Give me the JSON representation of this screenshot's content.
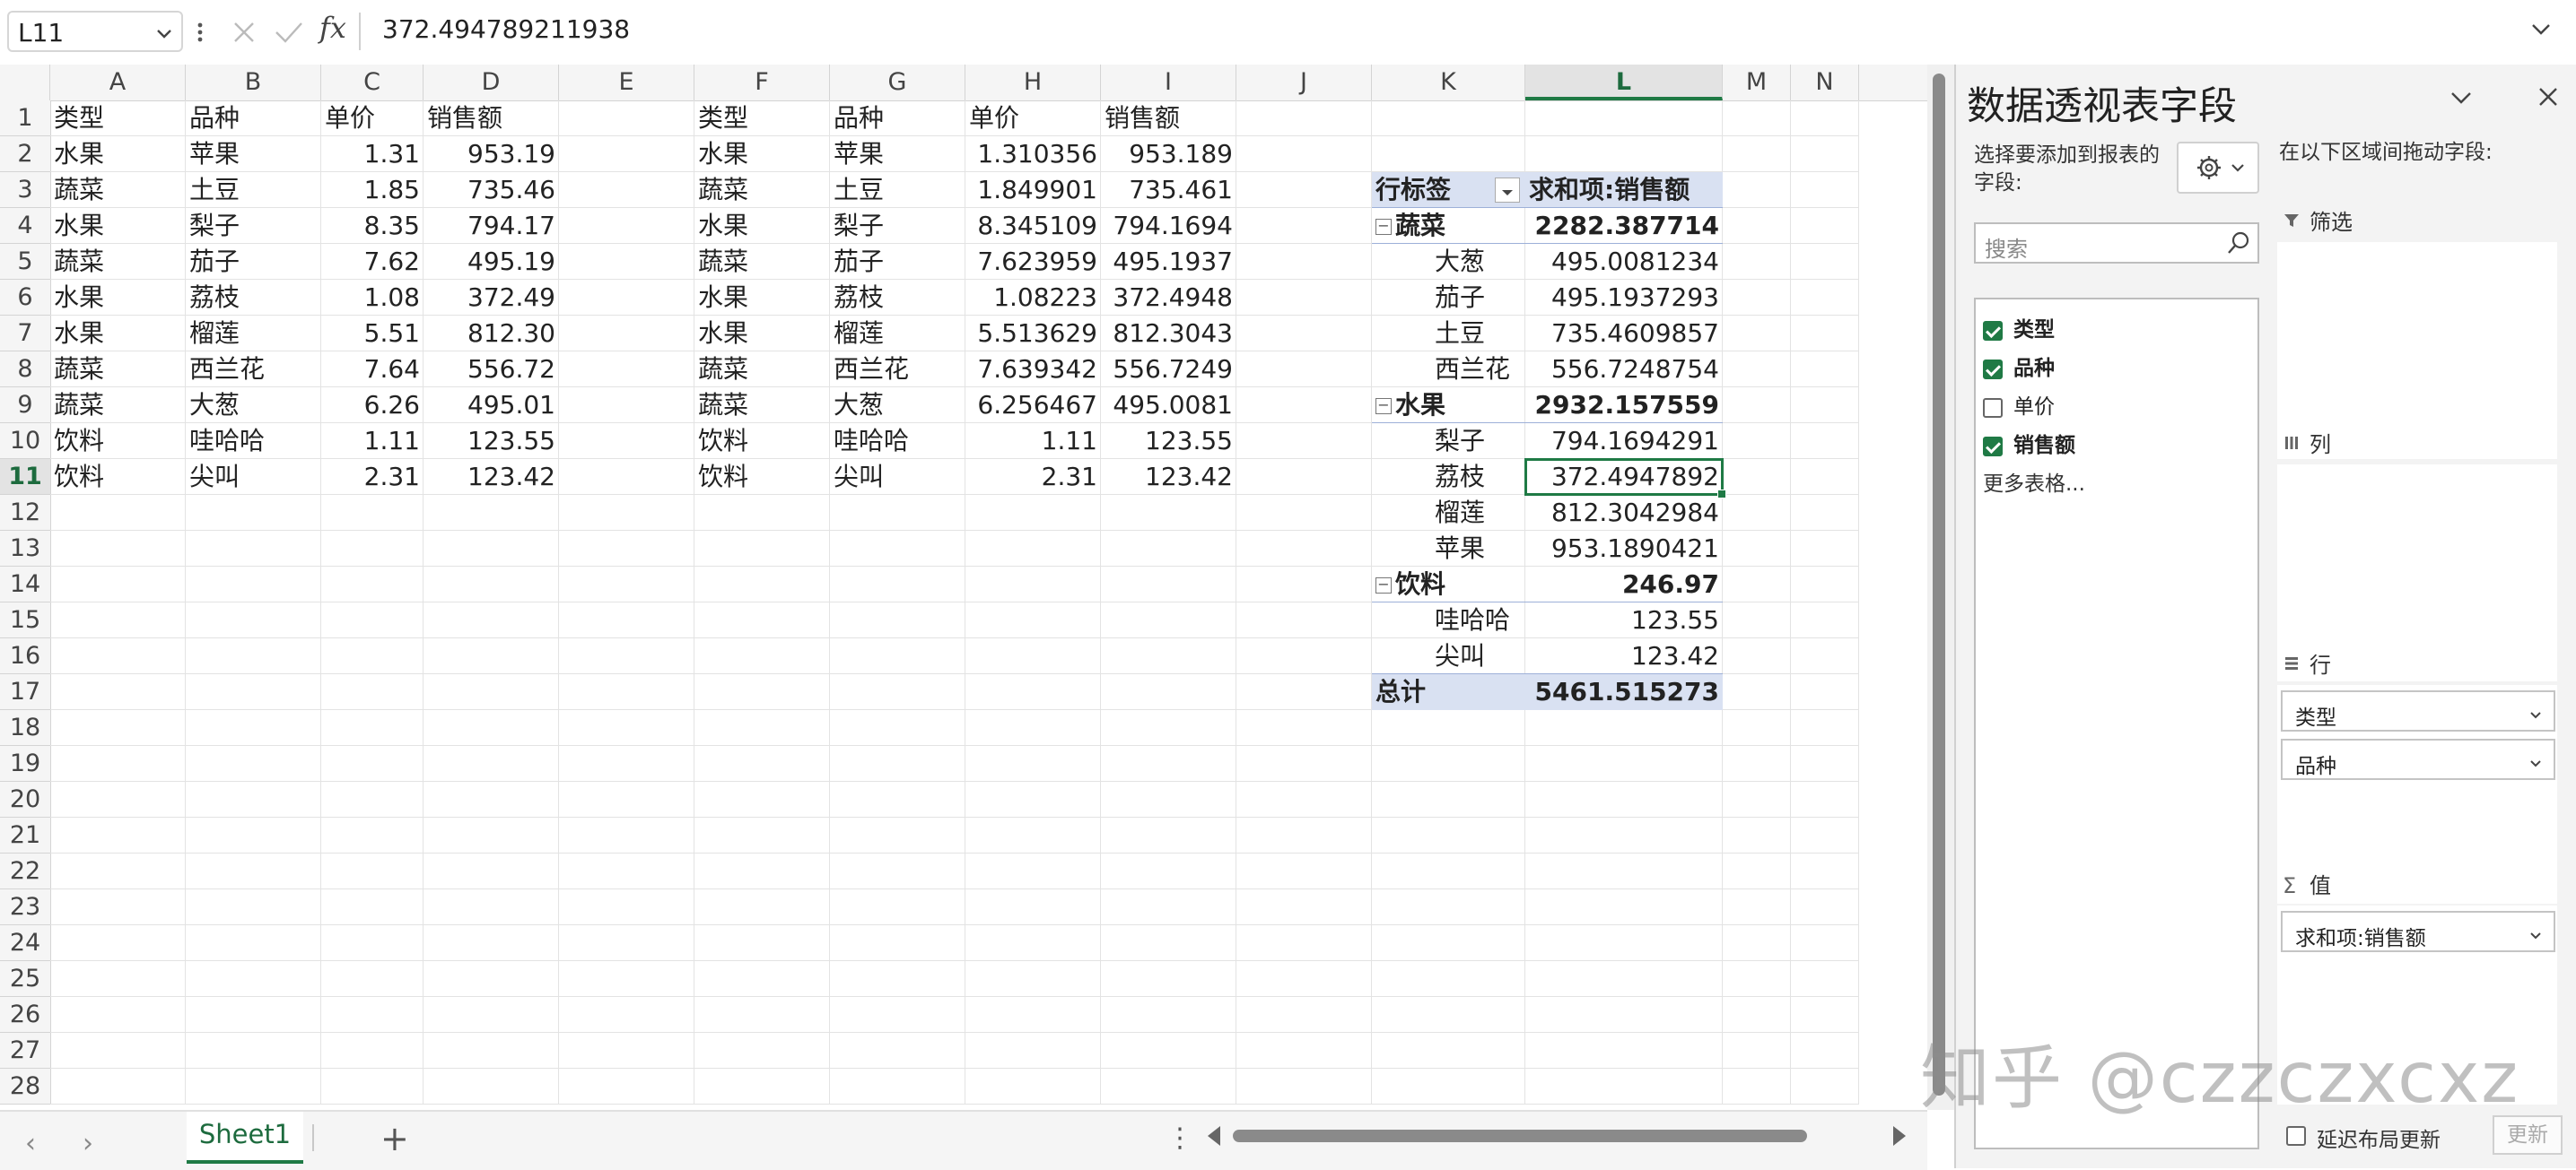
{
  "formula_bar": {
    "cell_ref": "L11",
    "content": "372.494789211938",
    "fx_label": "fx"
  },
  "grid": {
    "columns": [
      "A",
      "B",
      "C",
      "D",
      "E",
      "F",
      "G",
      "H",
      "I",
      "J",
      "K",
      "L",
      "M",
      "N"
    ],
    "rows": [
      "1",
      "2",
      "3",
      "4",
      "5",
      "6",
      "7",
      "8",
      "9",
      "10",
      "11",
      "12",
      "13",
      "14",
      "15",
      "16",
      "17",
      "18",
      "19",
      "20",
      "21",
      "22",
      "23",
      "24",
      "25",
      "26",
      "27",
      "28"
    ],
    "selected_column": "L",
    "selected_row": "11",
    "cells": {
      "A1": "类型",
      "B1": "品种",
      "C1": "单价",
      "D1": "销售额",
      "A2": "水果",
      "B2": "苹果",
      "C2": "1.31",
      "D2": "953.19",
      "A3": "蔬菜",
      "B3": "土豆",
      "C3": "1.85",
      "D3": "735.46",
      "A4": "水果",
      "B4": "梨子",
      "C4": "8.35",
      "D4": "794.17",
      "A5": "蔬菜",
      "B5": "茄子",
      "C5": "7.62",
      "D5": "495.19",
      "A6": "水果",
      "B6": "荔枝",
      "C6": "1.08",
      "D6": "372.49",
      "A7": "水果",
      "B7": "榴莲",
      "C7": "5.51",
      "D7": "812.30",
      "A8": "蔬菜",
      "B8": "西兰花",
      "C8": "7.64",
      "D8": "556.72",
      "A9": "蔬菜",
      "B9": "大葱",
      "C9": "6.26",
      "D9": "495.01",
      "A10": "饮料",
      "B10": "哇哈哈",
      "C10": "1.11",
      "D10": "123.55",
      "A11": "饮料",
      "B11": "尖叫",
      "C11": "2.31",
      "D11": "123.42",
      "F1": "类型",
      "G1": "品种",
      "H1": "单价",
      "I1": "销售额",
      "F2": "水果",
      "G2": "苹果",
      "H2": "1.310356",
      "I2": "953.189",
      "F3": "蔬菜",
      "G3": "土豆",
      "H3": "1.849901",
      "I3": "735.461",
      "F4": "水果",
      "G4": "梨子",
      "H4": "8.345109",
      "I4": "794.1694",
      "F5": "蔬菜",
      "G5": "茄子",
      "H5": "7.623959",
      "I5": "495.1937",
      "F6": "水果",
      "G6": "荔枝",
      "H6": "1.08223",
      "I6": "372.4948",
      "F7": "水果",
      "G7": "榴莲",
      "H7": "5.513629",
      "I7": "812.3043",
      "F8": "蔬菜",
      "G8": "西兰花",
      "H8": "7.639342",
      "I8": "556.7249",
      "F9": "蔬菜",
      "G9": "大葱",
      "H9": "6.256467",
      "I9": "495.0081",
      "F10": "饮料",
      "G10": "哇哈哈",
      "H10": "1.11",
      "I10": "123.55",
      "F11": "饮料",
      "G11": "尖叫",
      "H11": "2.31",
      "I11": "123.42",
      "K3": "行标签",
      "L3": "求和项:销售额",
      "K4": "蔬菜",
      "L4": "2282.387714",
      "K5": "大葱",
      "L5": "495.0081234",
      "K6": "茄子",
      "L6": "495.1937293",
      "K7": "土豆",
      "L7": "735.4609857",
      "K8": "西兰花",
      "L8": "556.7248754",
      "K9": "水果",
      "L9": "2932.157559",
      "K10": "梨子",
      "L10": "794.1694291",
      "K11": "荔枝",
      "L11": "372.4947892",
      "K12": "榴莲",
      "L12": "812.3042984",
      "K13": "苹果",
      "L13": "953.1890421",
      "K14": "饮料",
      "L14": "246.97",
      "K15": "哇哈哈",
      "L15": "123.55",
      "K16": "尖叫",
      "L16": "123.42",
      "K17": "总计",
      "L17": "5461.515273"
    }
  },
  "sheet_tabs": {
    "active": "Sheet1",
    "add_label": "+"
  },
  "pivot_pane": {
    "title": "数据透视表字段",
    "choose_label": "选择要添加到报表的字段:",
    "search_placeholder": "搜索",
    "fields": [
      {
        "name": "类型",
        "checked": true
      },
      {
        "name": "品种",
        "checked": true
      },
      {
        "name": "单价",
        "checked": false
      },
      {
        "name": "销售额",
        "checked": true
      }
    ],
    "more_tables": "更多表格...",
    "drag_label": "在以下区域间拖动字段:",
    "filter_label": "筛选",
    "columns_label": "列",
    "rows_label": "行",
    "row_fields": [
      "类型",
      "品种"
    ],
    "values_label": "值",
    "value_fields": [
      "求和项:销售额"
    ],
    "defer_label": "延迟布局更新",
    "update_label": "更新"
  },
  "watermark": "知乎 @czzczxcxz",
  "colors": {
    "accent": "#1f7a45",
    "pivot_header": "#d9e1f2"
  }
}
